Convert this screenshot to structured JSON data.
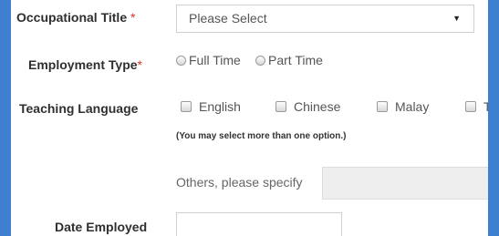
{
  "form": {
    "occupational_title": {
      "label": "Occupational Title",
      "required_mark": "*",
      "selected": "Please Select",
      "caret": "▼"
    },
    "employment_type": {
      "label": "Employment Type",
      "required_mark": "*",
      "options": [
        "Full Time",
        "Part Time"
      ]
    },
    "teaching_language": {
      "label": "Teaching Language",
      "options": [
        "English",
        "Chinese",
        "Malay",
        "Ta"
      ],
      "note": "(You may select more than one option.)",
      "others_label": "Others, please specify",
      "others_value": ""
    },
    "date_employed": {
      "label": "Date Employed",
      "value": ""
    }
  }
}
